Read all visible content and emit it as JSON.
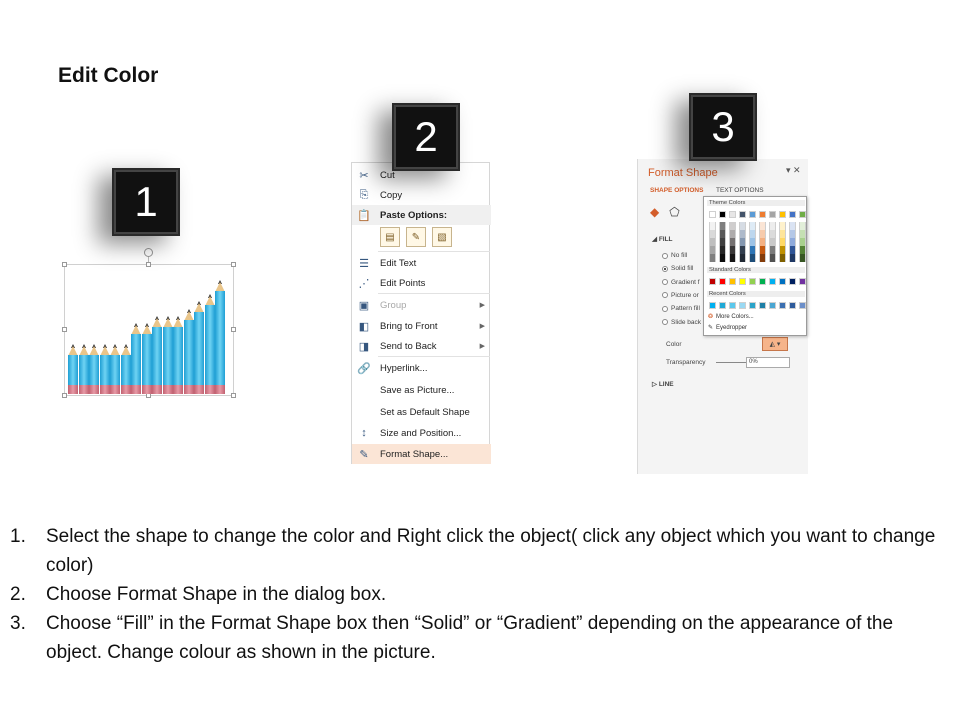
{
  "title": "Edit Color",
  "badges": [
    "1",
    "2",
    "3"
  ],
  "chart": {
    "pencil_values": [
      3,
      3,
      3,
      3,
      3,
      3,
      6,
      6,
      7,
      7,
      7,
      8,
      9,
      10,
      12
    ]
  },
  "context_menu": {
    "items": [
      {
        "icon": "cut-icon",
        "glyph": "✂",
        "label": "Cut",
        "state": "normal"
      },
      {
        "icon": "copy-icon",
        "glyph": "⎘",
        "label": "Copy",
        "state": "normal"
      },
      {
        "icon": "paste-icon",
        "glyph": "📋",
        "label": "Paste Options:",
        "state": "header"
      },
      {
        "icon": "edit-text-icon",
        "glyph": "☰",
        "label": "Edit Text",
        "state": "normal"
      },
      {
        "icon": "edit-points-icon",
        "glyph": "⋰",
        "label": "Edit Points",
        "state": "normal"
      },
      {
        "icon": "group-icon",
        "glyph": "▣",
        "label": "Group",
        "state": "disabled",
        "submenu": true
      },
      {
        "icon": "bring-front-icon",
        "glyph": "◧",
        "label": "Bring to Front",
        "state": "normal",
        "submenu": true
      },
      {
        "icon": "send-back-icon",
        "glyph": "◨",
        "label": "Send to Back",
        "state": "normal",
        "submenu": true
      },
      {
        "icon": "hyperlink-icon",
        "glyph": "🔗",
        "label": "Hyperlink...",
        "state": "normal"
      },
      {
        "icon": "",
        "glyph": "",
        "label": "Save as Picture...",
        "state": "normal"
      },
      {
        "icon": "",
        "glyph": "",
        "label": "Set as Default Shape",
        "state": "normal"
      },
      {
        "icon": "size-position-icon",
        "glyph": "↕",
        "label": "Size and Position...",
        "state": "normal"
      },
      {
        "icon": "format-shape-icon",
        "glyph": "✎",
        "label": "Format Shape...",
        "state": "highlight"
      }
    ]
  },
  "format_pane": {
    "title": "Format Shape",
    "controls": "▾ ✕",
    "tabs": [
      "SHAPE OPTIONS",
      "TEXT OPTIONS"
    ],
    "fill_section": "FILL",
    "fill_options": [
      {
        "label": "No fill",
        "checked": false
      },
      {
        "label": "Solid fill",
        "checked": true
      },
      {
        "label": "Gradient f",
        "checked": false
      },
      {
        "label": "Picture or",
        "checked": false
      },
      {
        "label": "Pattern fill",
        "checked": false
      },
      {
        "label": "Slide back",
        "checked": false
      }
    ],
    "color_label": "Color",
    "transparency_label": "Transparency",
    "transparency_value": "0%",
    "line_section": "LINE"
  },
  "palette": {
    "theme_label": "Theme Colors",
    "standard_label": "Standard Colors",
    "recent_label": "Recent Colors",
    "more_colors": "More Colors...",
    "eyedropper": "Eyedropper",
    "theme_top": [
      "#ffffff",
      "#000000",
      "#e7e6e6",
      "#44546a",
      "#5b9bd5",
      "#ed7d31",
      "#a5a5a5",
      "#ffc000",
      "#4472c4",
      "#70ad47"
    ],
    "theme_columns": [
      [
        "#f2f2f2",
        "#d9d9d9",
        "#bfbfbf",
        "#a6a6a6",
        "#808080"
      ],
      [
        "#7f7f7f",
        "#595959",
        "#404040",
        "#262626",
        "#0d0d0d"
      ],
      [
        "#d0cece",
        "#aeabab",
        "#757171",
        "#3a3838",
        "#171616"
      ],
      [
        "#d6dce4",
        "#adb9ca",
        "#8497b0",
        "#333f4f",
        "#222a35"
      ],
      [
        "#deebf6",
        "#bdd7ee",
        "#9dc3e6",
        "#2e75b5",
        "#1e4e79"
      ],
      [
        "#fbe5d5",
        "#f7cbac",
        "#f4b183",
        "#c55a11",
        "#843c0b"
      ],
      [
        "#ededed",
        "#dbdbdb",
        "#c9c9c9",
        "#7b7b7b",
        "#525252"
      ],
      [
        "#fff2cc",
        "#fee599",
        "#ffd965",
        "#bf9000",
        "#7f6000"
      ],
      [
        "#dae3f3",
        "#b4c7e7",
        "#8faadc",
        "#2f5496",
        "#1f3864"
      ],
      [
        "#e2efd9",
        "#c5e0b3",
        "#a8d08d",
        "#538135",
        "#375623"
      ]
    ],
    "standard": [
      "#c00000",
      "#ff0000",
      "#ffc000",
      "#ffff00",
      "#92d050",
      "#00b050",
      "#00b0f0",
      "#0070c0",
      "#002060",
      "#7030a0"
    ],
    "recent": [
      "#00b0f0",
      "#1fa9d6",
      "#5bc8ec",
      "#9ad9f3",
      "#2ba3c8",
      "#1d7fa6",
      "#4aa6d2",
      "#3b6fb0",
      "#2e5b9b",
      "#6c8fc9"
    ]
  },
  "steps": [
    {
      "num": "1.",
      "text": "Select the shape to change the color and Right click the object( click any object which you want to change color)"
    },
    {
      "num": "2.",
      "text": "Choose Format Shape in the dialog box."
    },
    {
      "num": "3.",
      "text": "Choose “Fill” in the Format Shape box then “Solid” or “Gradient” depending on the appearance of the object. Change colour as shown in the picture."
    }
  ]
}
